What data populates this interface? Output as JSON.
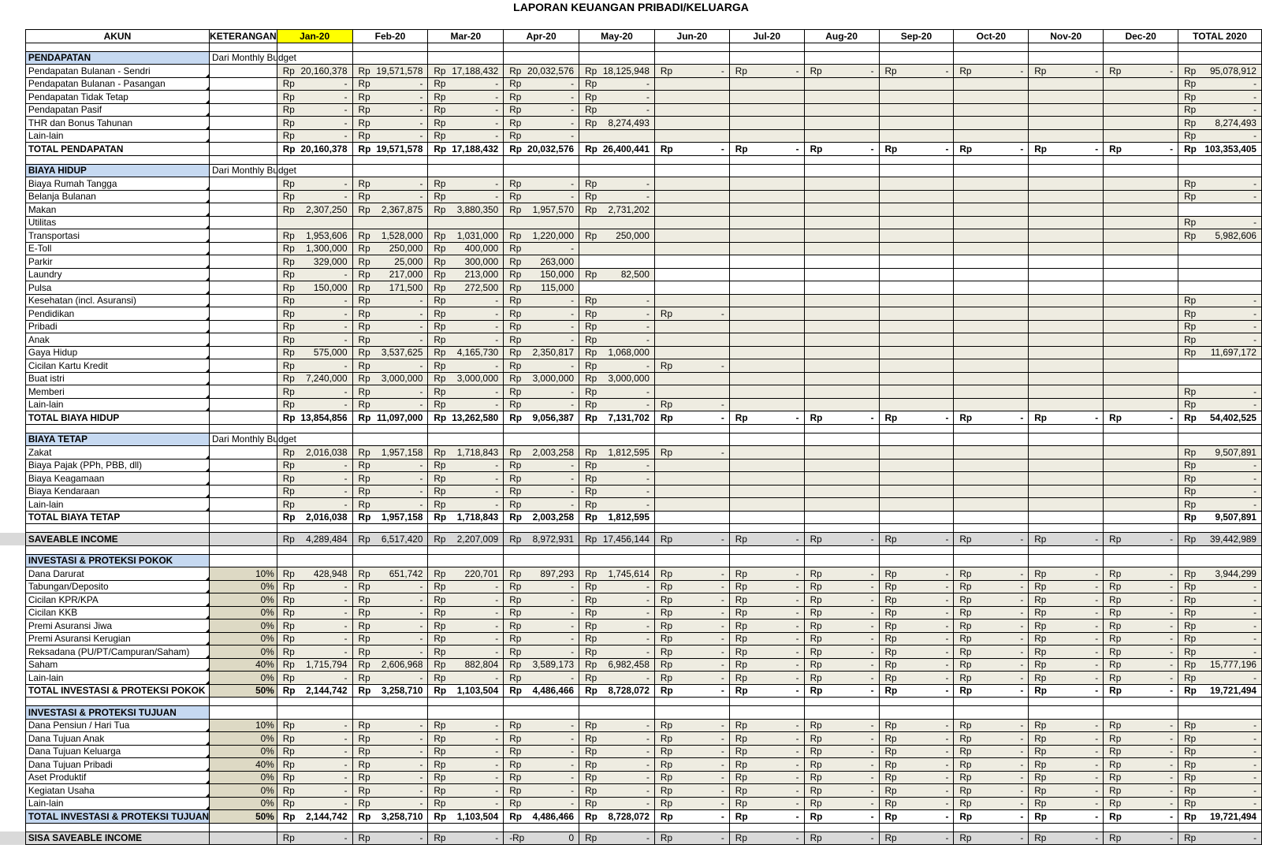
{
  "title": "LAPORAN KEUANGAN PRIBADI/KELUARGA",
  "headers": [
    "AKUN",
    "KETERANGAN",
    "Jan-20",
    "Feb-20",
    "Mar-20",
    "Apr-20",
    "May-20",
    "Jun-20",
    "Jul-20",
    "Aug-20",
    "Sep-20",
    "Oct-20",
    "Nov-20",
    "Dec-20",
    "TOTAL 2020"
  ],
  "rows": [
    {
      "t": "sp"
    },
    {
      "t": "sec",
      "label": "PENDAPATAN",
      "ket": "Dari Monthly Budget"
    },
    {
      "t": "d",
      "label": "Pendapatan Bulanan - Sendri",
      "m": [
        "20,160,378",
        "19,571,578",
        "17,188,432",
        "20,032,576",
        "18,125,948",
        "-",
        "-",
        "-",
        "-",
        "-",
        "-",
        "-"
      ],
      "total": "95,078,912",
      "shade": 12
    },
    {
      "t": "d",
      "label": "Pendapatan Bulanan - Pasangan",
      "m": [
        "-",
        "-",
        "-",
        "-",
        "-"
      ],
      "total": "-",
      "shade": 12
    },
    {
      "t": "d",
      "label": "Pendapatan Tidak Tetap",
      "m": [
        "-",
        "-",
        "-",
        "-",
        "-"
      ],
      "total": "-",
      "shade": 12
    },
    {
      "t": "d",
      "label": "Pendapatan Pasif",
      "m": [
        "-",
        "-",
        "-",
        "-",
        "-"
      ],
      "total": "-",
      "shade": 12
    },
    {
      "t": "d",
      "label": "THR dan Bonus Tahunan",
      "m": [
        "-",
        "-",
        "-",
        "-",
        "8,274,493"
      ],
      "total": "8,274,493",
      "shade": 12
    },
    {
      "t": "d",
      "label": "Lain-lain",
      "m": [
        "-",
        "-",
        "-",
        "-"
      ],
      "total": "-",
      "shade": 12
    },
    {
      "t": "tot",
      "label": "TOTAL PENDAPATAN",
      "m": [
        "20,160,378",
        "19,571,578",
        "17,188,432",
        "20,032,576",
        "26,400,441",
        "-",
        "-",
        "-",
        "-",
        "-",
        "-",
        "-"
      ],
      "total": "103,353,405"
    },
    {
      "t": "sp"
    },
    {
      "t": "sec",
      "label": "BIAYA HIDUP",
      "ket": "Dari Monthly Budget"
    },
    {
      "t": "d",
      "label": "Biaya Rumah Tangga",
      "m": [
        "-",
        "-",
        "-",
        "-",
        "-"
      ],
      "total": "-",
      "shade": 12
    },
    {
      "t": "d",
      "label": "Belanja Bulanan",
      "m": [
        "-",
        "-",
        "-",
        "-",
        "-"
      ],
      "total": "-",
      "shade": 12
    },
    {
      "t": "d",
      "label": "Makan",
      "m": [
        "2,307,250",
        "2,367,875",
        "3,880,350",
        "1,957,570",
        "2,731,202"
      ],
      "total": null,
      "shade": 12
    },
    {
      "t": "d",
      "label": "Utilitas",
      "m": [],
      "total": "-",
      "shade": 12
    },
    {
      "t": "d",
      "label": "Transportasi",
      "m": [
        "1,953,606",
        "1,528,000",
        "1,031,000",
        "1,220,000",
        "250,000"
      ],
      "total": "5,982,606",
      "shade": 12
    },
    {
      "t": "d",
      "label": "E-Toll",
      "m": [
        "1,300,000",
        "250,000",
        "400,000",
        "-"
      ],
      "total": null,
      "shade": 12
    },
    {
      "t": "d",
      "label": "Parkir",
      "m": [
        "329,000",
        "25,000",
        "300,000",
        "263,000"
      ],
      "total": null,
      "shade": 4
    },
    {
      "t": "d",
      "label": "Laundry",
      "m": [
        "-",
        "217,000",
        "213,000",
        "150,000",
        "82,500"
      ],
      "total": null,
      "shade": 5
    },
    {
      "t": "d",
      "label": "Pulsa",
      "m": [
        "150,000",
        "171,500",
        "272,500",
        "115,000"
      ],
      "total": null,
      "shade": 4
    },
    {
      "t": "d",
      "label": "Kesehatan (incl. Asuransi)",
      "m": [
        "-",
        "-",
        "-",
        "-",
        "-"
      ],
      "total": "-",
      "shade": 12
    },
    {
      "t": "d",
      "label": "Pendidikan",
      "m": [
        "-",
        "-",
        "-",
        "-",
        "-",
        "-"
      ],
      "total": "-",
      "shade": 12
    },
    {
      "t": "d",
      "label": "Pribadi",
      "m": [
        "-",
        "-",
        "-",
        "-",
        "-"
      ],
      "total": "-",
      "shade": 12
    },
    {
      "t": "d",
      "label": "Anak",
      "m": [
        "-",
        "-",
        "-",
        "-",
        "-"
      ],
      "total": "-",
      "shade": 12
    },
    {
      "t": "d",
      "label": "Gaya Hidup",
      "m": [
        "575,000",
        "3,537,625",
        "4,165,730",
        "2,350,817",
        "1,068,000"
      ],
      "total": "11,697,172",
      "shade": 12
    },
    {
      "t": "d",
      "label": "Cicilan Kartu Kredit",
      "m": [
        "-",
        "-",
        "-",
        "-",
        "-",
        "-"
      ],
      "total": null,
      "shade": 12
    },
    {
      "t": "d",
      "label": "Buat istri",
      "m": [
        "7,240,000",
        "3,000,000",
        "3,000,000",
        "3,000,000",
        "3,000,000"
      ],
      "total": null,
      "shade": 12
    },
    {
      "t": "d",
      "label": "Memberi",
      "m": [
        "-",
        "-",
        "-",
        "-",
        "-"
      ],
      "total": "-",
      "shade": 12
    },
    {
      "t": "d",
      "label": "Lain-lain",
      "m": [
        "-",
        "-",
        "-",
        "-",
        "-",
        "-"
      ],
      "total": "-",
      "shade": 12
    },
    {
      "t": "tot",
      "label": "TOTAL BIAYA HIDUP",
      "m": [
        "13,854,856",
        "11,097,000",
        "13,262,580",
        "9,056,387",
        "7,131,702",
        "-",
        "-",
        "-",
        "-",
        "-",
        "-",
        "-"
      ],
      "total": "54,402,525"
    },
    {
      "t": "sp"
    },
    {
      "t": "sec",
      "label": "BIAYA TETAP",
      "ket": "Dari Monthly Budget"
    },
    {
      "t": "d",
      "label": "Zakat",
      "m": [
        "2,016,038",
        "1,957,158",
        "1,718,843",
        "2,003,258",
        "1,812,595",
        "-"
      ],
      "total": "9,507,891",
      "shade": 12
    },
    {
      "t": "d",
      "label": "Biaya Pajak (PPh, PBB, dll)",
      "m": [
        "-",
        "-",
        "-",
        "-",
        "-"
      ],
      "total": "-",
      "shade": 12
    },
    {
      "t": "d",
      "label": "Biaya Keagamaan",
      "m": [
        "-",
        "-",
        "-",
        "-",
        "-"
      ],
      "total": "-",
      "shade": 12
    },
    {
      "t": "d",
      "label": "Biaya Kendaraan",
      "m": [
        "-",
        "-",
        "-",
        "-",
        "-"
      ],
      "total": "-",
      "shade": 12
    },
    {
      "t": "d",
      "label": "Lain-lain",
      "m": [
        "-",
        "-",
        "-",
        "-",
        "-"
      ],
      "total": "-",
      "shade": 12
    },
    {
      "t": "tot",
      "label": "TOTAL BIAYA TETAP",
      "m": [
        "2,016,038",
        "1,957,158",
        "1,718,843",
        "2,003,258",
        "1,812,595"
      ],
      "total": "9,507,891"
    },
    {
      "t": "sp"
    },
    {
      "t": "sav",
      "label": "SAVEABLE INCOME",
      "m": [
        "4,289,484",
        "6,517,420",
        "2,207,009",
        "8,972,931",
        "17,456,144",
        "-",
        "-",
        "-",
        "-",
        "-",
        "-",
        "-"
      ],
      "total": "39,442,989"
    },
    {
      "t": "sp"
    },
    {
      "t": "sec",
      "label": "INVESTASI & PROTEKSI POKOK",
      "ket": ""
    },
    {
      "t": "d",
      "label": "Dana Darurat",
      "pct": "10%",
      "m": [
        "428,948",
        "651,742",
        "220,701",
        "897,293",
        "1,745,614",
        "-",
        "-",
        "-",
        "-",
        "-",
        "-",
        "-"
      ],
      "total": "3,944,299",
      "shade": 12
    },
    {
      "t": "d",
      "label": "Tabungan/Deposito",
      "pct": "0%",
      "m": [
        "-",
        "-",
        "-",
        "-",
        "-",
        "-",
        "-",
        "-",
        "-",
        "-",
        "-",
        "-"
      ],
      "total": "-",
      "shade": 12
    },
    {
      "t": "d",
      "label": "Cicilan KPR/KPA",
      "pct": "0%",
      "m": [
        "-",
        "-",
        "-",
        "-",
        "-",
        "-",
        "-",
        "-",
        "-",
        "-",
        "-",
        "-"
      ],
      "total": "-",
      "shade": 12
    },
    {
      "t": "d",
      "label": "Cicilan KKB",
      "pct": "0%",
      "m": [
        "-",
        "-",
        "-",
        "-",
        "-",
        "-",
        "-",
        "-",
        "-",
        "-",
        "-",
        "-"
      ],
      "total": "-",
      "shade": 12
    },
    {
      "t": "d",
      "label": "Premi Asuransi Jiwa",
      "pct": "0%",
      "m": [
        "-",
        "-",
        "-",
        "-",
        "-",
        "-",
        "-",
        "-",
        "-",
        "-",
        "-",
        "-"
      ],
      "total": "-",
      "shade": 12
    },
    {
      "t": "d",
      "label": "Premi Asuransi Kerugian",
      "pct": "0%",
      "m": [
        "-",
        "-",
        "-",
        "-",
        "-",
        "-",
        "-",
        "-",
        "-",
        "-",
        "-",
        "-"
      ],
      "total": "-",
      "shade": 12
    },
    {
      "t": "d",
      "label": "Reksadana (PU/PT/Campuran/Saham)",
      "pct": "0%",
      "m": [
        "-",
        "-",
        "-",
        "-",
        "-",
        "-",
        "-",
        "-",
        "-",
        "-",
        "-",
        "-"
      ],
      "total": "-",
      "shade": 12
    },
    {
      "t": "d",
      "label": "Saham",
      "pct": "40%",
      "m": [
        "1,715,794",
        "2,606,968",
        "882,804",
        "3,589,173",
        "6,982,458",
        "-",
        "-",
        "-",
        "-",
        "-",
        "-",
        "-"
      ],
      "total": "15,777,196",
      "shade": 12
    },
    {
      "t": "d",
      "label": "Lain-lain",
      "pct": "0%",
      "m": [
        "-",
        "-",
        "-",
        "-",
        "-",
        "-",
        "-",
        "-",
        "-",
        "-",
        "-",
        "-"
      ],
      "total": "-",
      "shade": 12
    },
    {
      "t": "tot",
      "label": "TOTAL INVESTASI & PROTEKSI POKOK",
      "pct": "50%",
      "m": [
        "2,144,742",
        "3,258,710",
        "1,103,504",
        "4,486,466",
        "8,728,072",
        "-",
        "-",
        "-",
        "-",
        "-",
        "-",
        "-"
      ],
      "total": "19,721,494"
    },
    {
      "t": "sp"
    },
    {
      "t": "sec",
      "label": "INVESTASI & PROTEKSI TUJUAN",
      "ket": ""
    },
    {
      "t": "d",
      "label": "Dana Pensiun / Hari Tua",
      "pct": "10%",
      "m": [
        "-",
        "-",
        "-",
        "-",
        "-",
        "-",
        "-",
        "-",
        "-",
        "-",
        "-",
        "-"
      ],
      "total": "-",
      "shade": 12
    },
    {
      "t": "d",
      "label": "Dana Tujuan Anak",
      "pct": "0%",
      "m": [
        "-",
        "-",
        "-",
        "-",
        "-",
        "-",
        "-",
        "-",
        "-",
        "-",
        "-",
        "-"
      ],
      "total": "-",
      "shade": 12
    },
    {
      "t": "d",
      "label": "Dana Tujuan Keluarga",
      "pct": "0%",
      "m": [
        "-",
        "-",
        "-",
        "-",
        "-",
        "-",
        "-",
        "-",
        "-",
        "-",
        "-",
        "-"
      ],
      "total": "-",
      "shade": 12
    },
    {
      "t": "d",
      "label": "Dana Tujuan Pribadi",
      "pct": "40%",
      "m": [
        "-",
        "-",
        "-",
        "-",
        "-",
        "-",
        "-",
        "-",
        "-",
        "-",
        "-",
        "-"
      ],
      "total": "-",
      "shade": 12
    },
    {
      "t": "d",
      "label": "Aset Produktif",
      "pct": "0%",
      "m": [
        "-",
        "-",
        "-",
        "-",
        "-",
        "-",
        "-",
        "-",
        "-",
        "-",
        "-",
        "-"
      ],
      "total": "-",
      "shade": 12
    },
    {
      "t": "d",
      "label": "Kegiatan Usaha",
      "pct": "0%",
      "m": [
        "-",
        "-",
        "-",
        "-",
        "-",
        "-",
        "-",
        "-",
        "-",
        "-",
        "-",
        "-"
      ],
      "total": "-",
      "shade": 12
    },
    {
      "t": "d",
      "label": "Lain-lain",
      "pct": "0%",
      "m": [
        "-",
        "-",
        "-",
        "-",
        "-",
        "-",
        "-",
        "-",
        "-",
        "-",
        "-",
        "-"
      ],
      "total": "-",
      "shade": 12
    },
    {
      "t": "tot",
      "label": "TOTAL INVESTASI & PROTEKSI TUJUAN",
      "pct": "50%",
      "m": [
        "2,144,742",
        "3,258,710",
        "1,103,504",
        "4,486,466",
        "8,728,072",
        "-",
        "-",
        "-",
        "-",
        "-",
        "-",
        "-"
      ],
      "total": "19,721,494",
      "blue": true
    },
    {
      "t": "sp"
    },
    {
      "t": "sav",
      "label": "SISA SAVEABLE INCOME",
      "m": [
        "-",
        "-",
        "-",
        "0",
        "-",
        "-",
        "-",
        "-",
        "-",
        "-",
        "-",
        "-"
      ],
      "total": "-",
      "neg": [
        false,
        false,
        false,
        true,
        false,
        false,
        false,
        false,
        false,
        false,
        false,
        false
      ]
    }
  ],
  "currency": "Rp"
}
